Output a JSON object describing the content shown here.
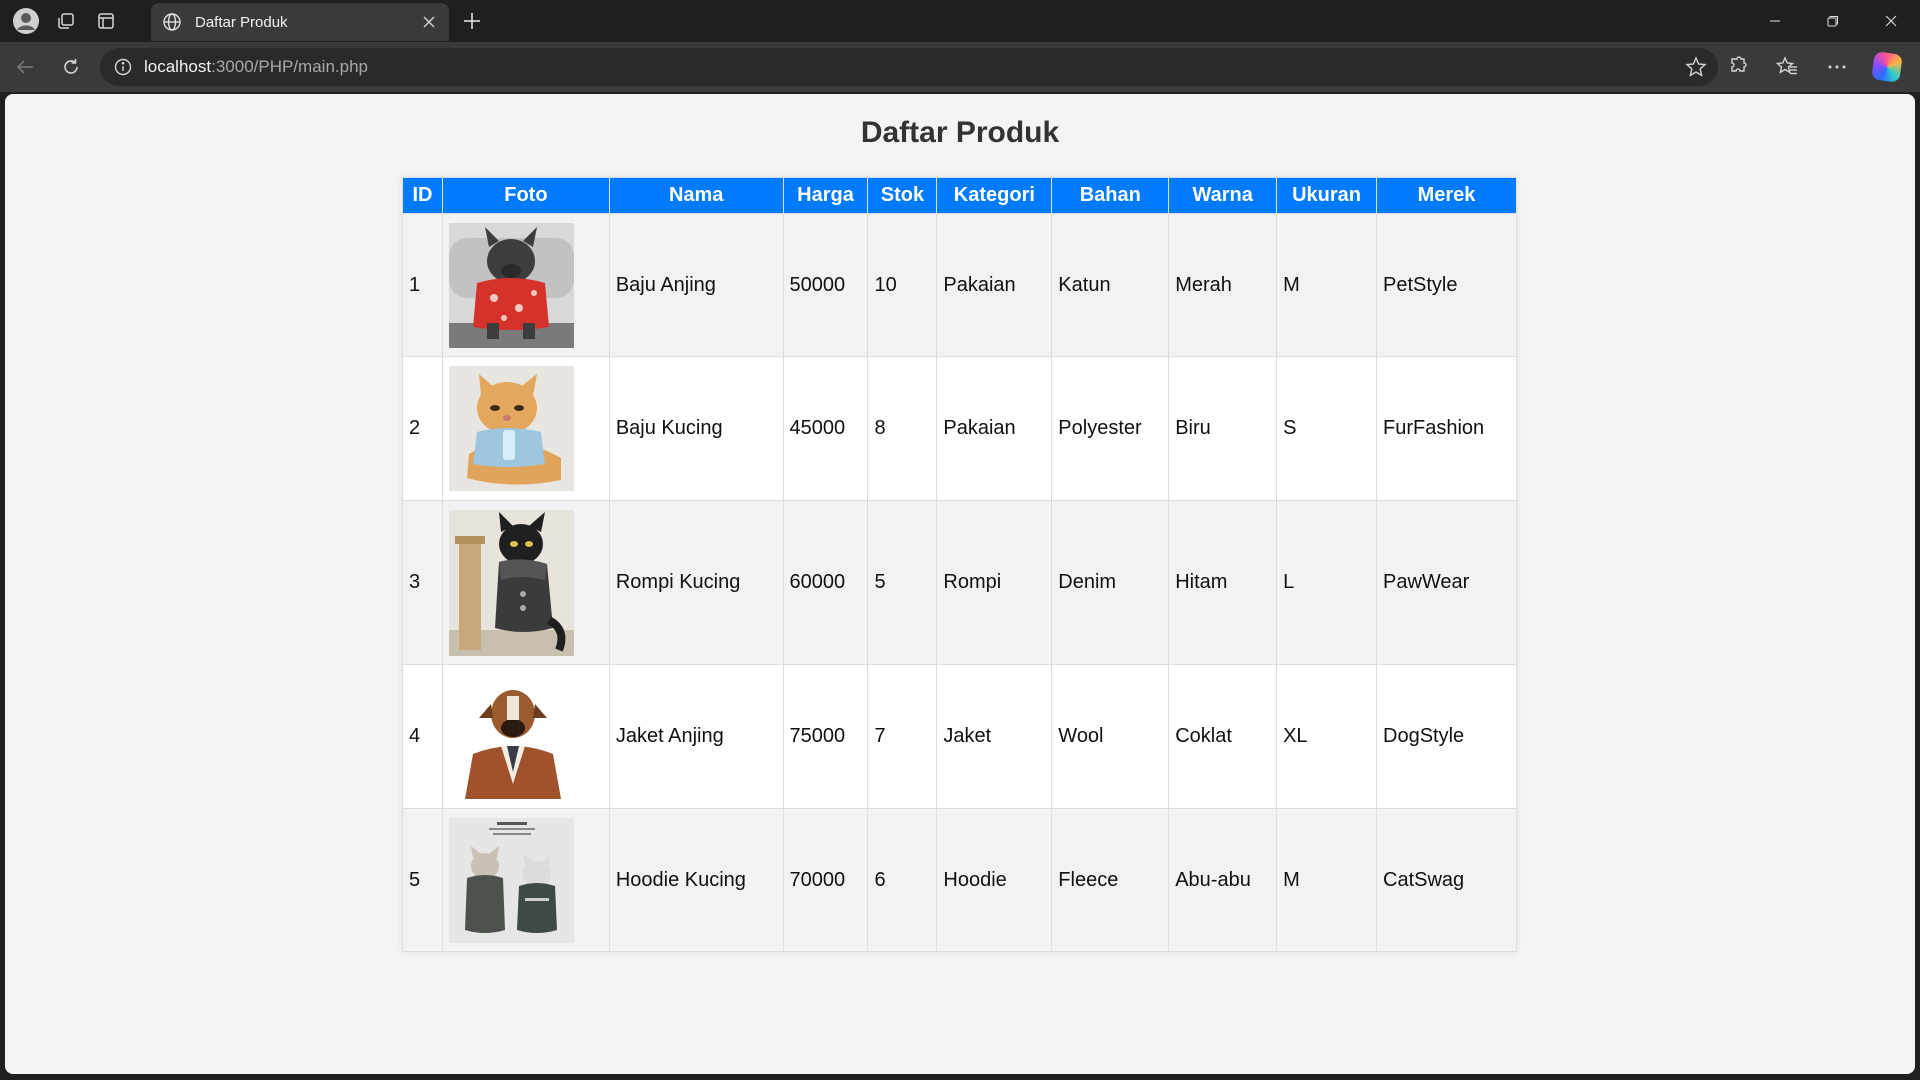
{
  "browser": {
    "tab_title": "Daftar Produk",
    "url_host": "localhost",
    "url_path": ":3000/PHP/main.php"
  },
  "page": {
    "title": "Daftar Produk"
  },
  "table": {
    "headers": {
      "id": "ID",
      "foto": "Foto",
      "nama": "Nama",
      "harga": "Harga",
      "stok": "Stok",
      "kategori": "Kategori",
      "bahan": "Bahan",
      "warna": "Warna",
      "ukuran": "Ukuran",
      "merek": "Merek"
    },
    "rows": [
      {
        "id": "1",
        "photo_subject": "french-bulldog-red-sweater",
        "nama": "Baju Anjing",
        "harga": "50000",
        "stok": "10",
        "kategori": "Pakaian",
        "bahan": "Katun",
        "warna": "Merah",
        "ukuran": "M",
        "merek": "PetStyle"
      },
      {
        "id": "2",
        "photo_subject": "cat-blue-sweater",
        "nama": "Baju Kucing",
        "harga": "45000",
        "stok": "8",
        "kategori": "Pakaian",
        "bahan": "Polyester",
        "warna": "Biru",
        "ukuran": "S",
        "merek": "FurFashion"
      },
      {
        "id": "3",
        "photo_subject": "black-cat-vest",
        "nama": "Rompi Kucing",
        "harga": "60000",
        "stok": "5",
        "kategori": "Rompi",
        "bahan": "Denim",
        "warna": "Hitam",
        "ukuran": "L",
        "merek": "PawWear"
      },
      {
        "id": "4",
        "photo_subject": "boxer-dog-leather-jacket",
        "nama": "Jaket Anjing",
        "harga": "75000",
        "stok": "7",
        "kategori": "Jaket",
        "bahan": "Wool",
        "warna": "Coklat",
        "ukuran": "XL",
        "merek": "DogStyle"
      },
      {
        "id": "5",
        "photo_subject": "two-cats-hoodies",
        "nama": "Hoodie Kucing",
        "harga": "70000",
        "stok": "6",
        "kategori": "Hoodie",
        "bahan": "Fleece",
        "warna": "Abu-abu",
        "ukuran": "M",
        "merek": "CatSwag"
      }
    ]
  },
  "colors": {
    "header_bg": "#007bff",
    "odd_row_bg": "#f2f2f2",
    "even_row_bg": "#ffffff",
    "page_bg": "#f4f4f4",
    "title_color": "#333333"
  }
}
